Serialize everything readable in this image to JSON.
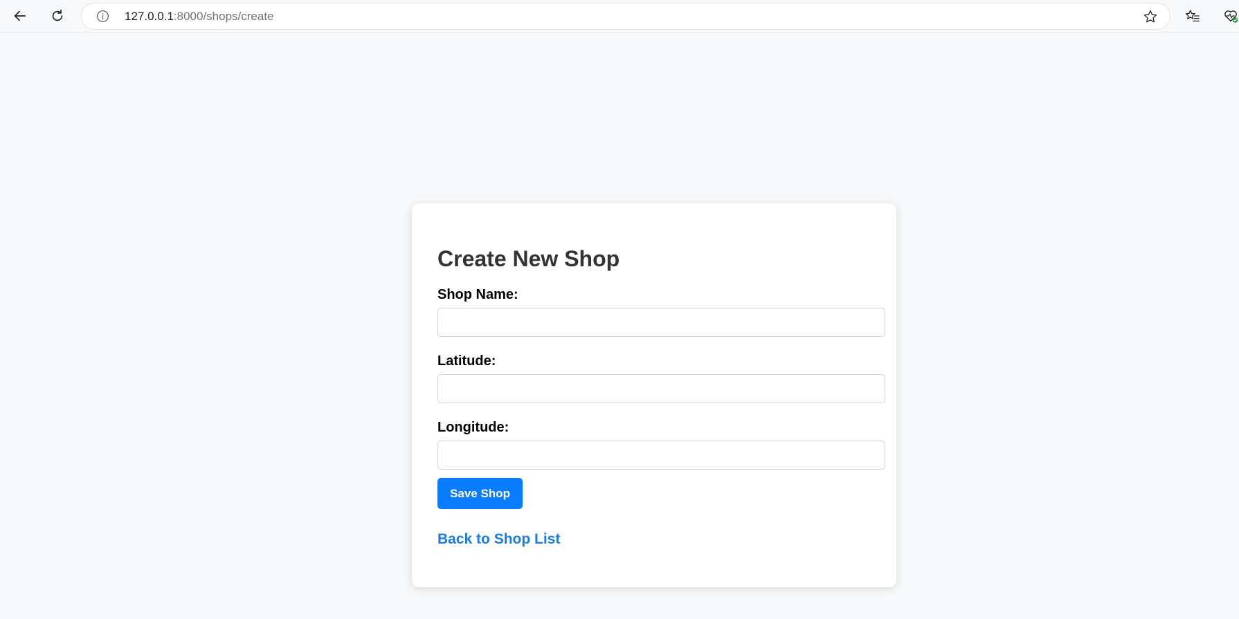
{
  "browser": {
    "url_host": "127.0.0.1",
    "url_rest": ":8000/shops/create",
    "icons": {
      "back": "back-arrow-icon",
      "reload": "reload-icon",
      "info": "info-icon",
      "star": "star-icon",
      "favorites": "favorites-icon",
      "extension": "extension-icon"
    }
  },
  "form": {
    "title": "Create New Shop",
    "fields": [
      {
        "label": "Shop Name:",
        "value": "",
        "placeholder": ""
      },
      {
        "label": "Latitude:",
        "value": "",
        "placeholder": ""
      },
      {
        "label": "Longitude:",
        "value": "",
        "placeholder": ""
      }
    ],
    "save_label": "Save Shop",
    "back_link_label": "Back to Shop List"
  },
  "colors": {
    "primary_button": "#0a7cff",
    "link": "#1a7de3",
    "page_background": "#f7f8f9",
    "extension_badge": "#1e8e3e"
  }
}
